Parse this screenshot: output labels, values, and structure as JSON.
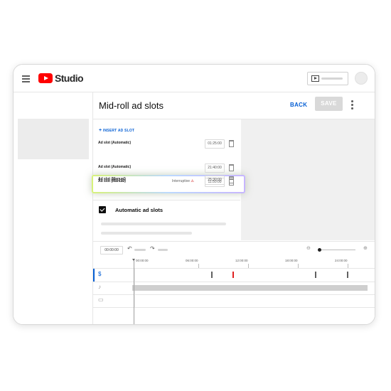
{
  "app": {
    "name": "Studio"
  },
  "page": {
    "title": "Mid-roll ad slots",
    "back_label": "BACK",
    "save_label": "SAVE"
  },
  "panel": {
    "insert_label": "INSERT AD SLOT",
    "slots": [
      {
        "label": "Ad slot (Automatic)",
        "time": "01:25:00",
        "warning": ""
      },
      {
        "label": "Ad slot (Manual)",
        "time": "11:50:00",
        "warning": "Interruptive"
      },
      {
        "label": "Ad slot (Automatic)",
        "time": "21:40:00",
        "warning": ""
      },
      {
        "label": "Ad slot (Manual)",
        "time": "25:30:00",
        "warning": ""
      }
    ],
    "auto_label": "Automatic ad slots",
    "auto_checked": true
  },
  "timeline": {
    "current_time": "00:00:00",
    "ruler_ticks": [
      "00:00:00",
      "06:00:00",
      "12:00:00",
      "18:00:00",
      "24:00:00"
    ]
  },
  "colors": {
    "accent": "#065fd4",
    "brand": "#ff0000",
    "warning": "#cc0000"
  },
  "icons": {
    "menu": "hamburger-icon",
    "create": "create-video-icon",
    "insert": "plus-icon",
    "delete": "trash-icon",
    "warning": "warning-icon",
    "undo": "undo-icon",
    "redo": "redo-icon",
    "zoom_out": "zoom-out-icon",
    "zoom_in": "zoom-in-icon",
    "ad_track": "dollar-icon",
    "audio_track": "music-note-icon",
    "video_track": "video-icon"
  }
}
